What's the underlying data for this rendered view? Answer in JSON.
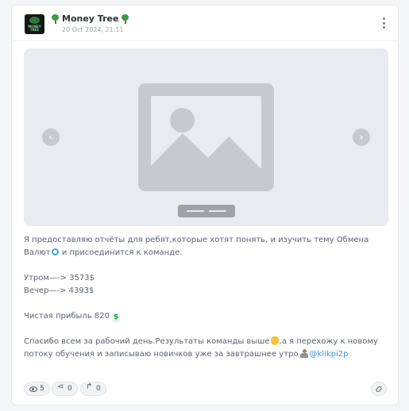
{
  "post": {
    "channel_name": "Money Tree",
    "date": "20 Oct 2024, 21:11",
    "avatar_text": "MONEY TREE"
  },
  "media": {
    "prev_icon": "chevron-left-icon",
    "next_icon": "chevron-right-icon",
    "placeholder_icon": "image-placeholder-icon"
  },
  "message": {
    "p1_a": "Я предоставляю отчёты для ребят,которые хотят понять, и изучить тему Обмена Валют",
    "p1_b": " и присоединится к команде.",
    "morning": "Утром—-> 3573$",
    "evening": "Вечер—-> 4393$",
    "profit": "Чистая прибыль 820 ",
    "thanks_a": "Спасибо всем за рабочий день.Результаты команды выше",
    "thanks_b": ",а я перехожу к новому потоку обучения и записываю новичков уже за завтрашнее утро",
    "mention": "@klikpi2p",
    "dollar_glyph": "$"
  },
  "footer": {
    "views": "5",
    "shares": "0",
    "forwards": "0"
  },
  "colors": {
    "mention": "#3d8fd6",
    "placeholder": "#c6c9cf",
    "media_bg": "#e8ebf0"
  }
}
